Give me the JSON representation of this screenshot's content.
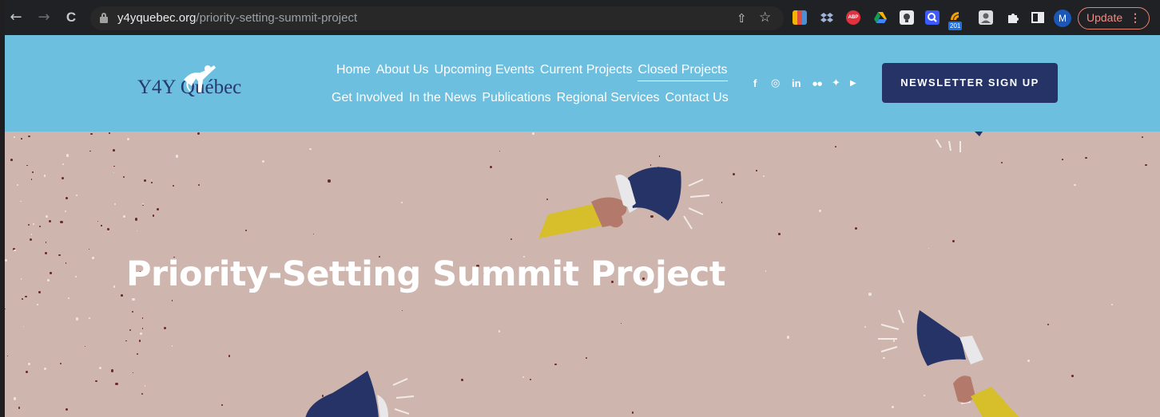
{
  "browser": {
    "url_host": "y4yquebec.org",
    "url_path": "/priority-setting-summit-project",
    "nav": {
      "back_icon": "←",
      "forward_icon": "→",
      "reload_icon": "C"
    },
    "share_icon": "⇧",
    "star_icon": "☆",
    "extension_abp_label": "ABP",
    "extension_badge": "201",
    "avatar_letter": "M",
    "update_label": "Update",
    "update_menu_icon": "⋮"
  },
  "site": {
    "logo_text": "Y4Y Québec",
    "menu_row1": [
      "Home",
      "About Us",
      "Upcoming Events",
      "Current Projects",
      "Closed Projects"
    ],
    "menu_row2": [
      "Get Involved",
      "In the News",
      "Publications",
      "Regional Services",
      "Contact Us"
    ],
    "active_item": "Closed Projects",
    "socials": [
      "f",
      "◎",
      "in",
      "●●",
      "✦",
      "▶"
    ],
    "newsletter_label": "NEWSLETTER SIGN UP"
  },
  "hero": {
    "title": "Priority-Setting Summit Project"
  },
  "colors": {
    "header_bg": "#6cbfdf",
    "hero_bg": "#ceb5ad",
    "button_navy": "#253366",
    "megaphone_navy": "#253366",
    "sleeve_yellow": "#d6bf2a",
    "skin": "#b37a6b"
  }
}
